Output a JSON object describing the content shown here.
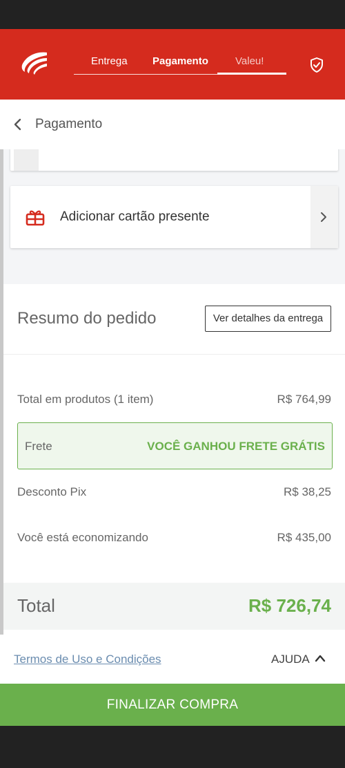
{
  "colors": {
    "brand_red": "#d52b1e",
    "accent_green": "#6ab04c",
    "dark_bar": "#222222",
    "link_blue": "#6a8caf"
  },
  "header": {
    "logo_icon": "brand-logo-swoosh",
    "steps": [
      {
        "label": "Entrega",
        "state": "done"
      },
      {
        "label": "Pagamento",
        "state": "active"
      },
      {
        "label": "Valeu!",
        "state": "pending"
      }
    ],
    "security_icon": "shield-check-icon"
  },
  "subheader": {
    "title": "Pagamento",
    "back_icon": "chevron-left-icon"
  },
  "gift_card": {
    "label": "Adicionar cartão presente",
    "icon": "gift-card-icon",
    "arrow_icon": "chevron-right-icon"
  },
  "summary": {
    "title": "Resumo do pedido",
    "details_button": "Ver detalhes da entrega",
    "products_label": "Total em produtos (1 item)",
    "products_value": "R$ 764,99",
    "shipping_label": "Frete",
    "shipping_value": "VOCÊ GANHOU FRETE GRÁTIS",
    "pix_label": "Desconto Pix",
    "pix_value": "R$ 38,25",
    "savings_label": "Você está economizando",
    "savings_value": "R$ 435,00",
    "total_label": "Total",
    "total_value": "R$ 726,74"
  },
  "footer": {
    "terms_link": "Termos de Uso e Condições",
    "help_label": "AJUDA",
    "help_icon": "chevron-up-icon"
  },
  "cta": {
    "label": "FINALIZAR COMPRA"
  }
}
